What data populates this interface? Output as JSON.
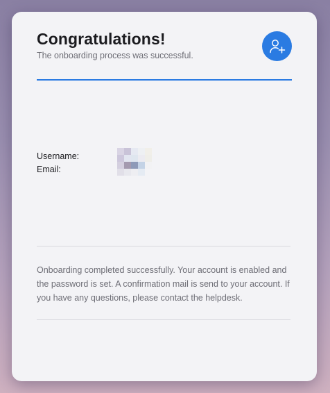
{
  "header": {
    "title": "Congratulations!",
    "subtitle": "The onboarding process was successful.",
    "action_icon": "add-user-icon"
  },
  "account": {
    "username_label": "Username:",
    "email_label": "Email:",
    "values_redacted": true
  },
  "message": "Onboarding completed successfully. Your account is enabled and the password is set. A confirmation mail is send to your account. If you have any questions, please contact the helpdesk.",
  "colors": {
    "accent": "#2a7be2",
    "card": "#f3f3f6",
    "title_text": "#1b1b1f",
    "muted_text": "#6e6e76"
  }
}
